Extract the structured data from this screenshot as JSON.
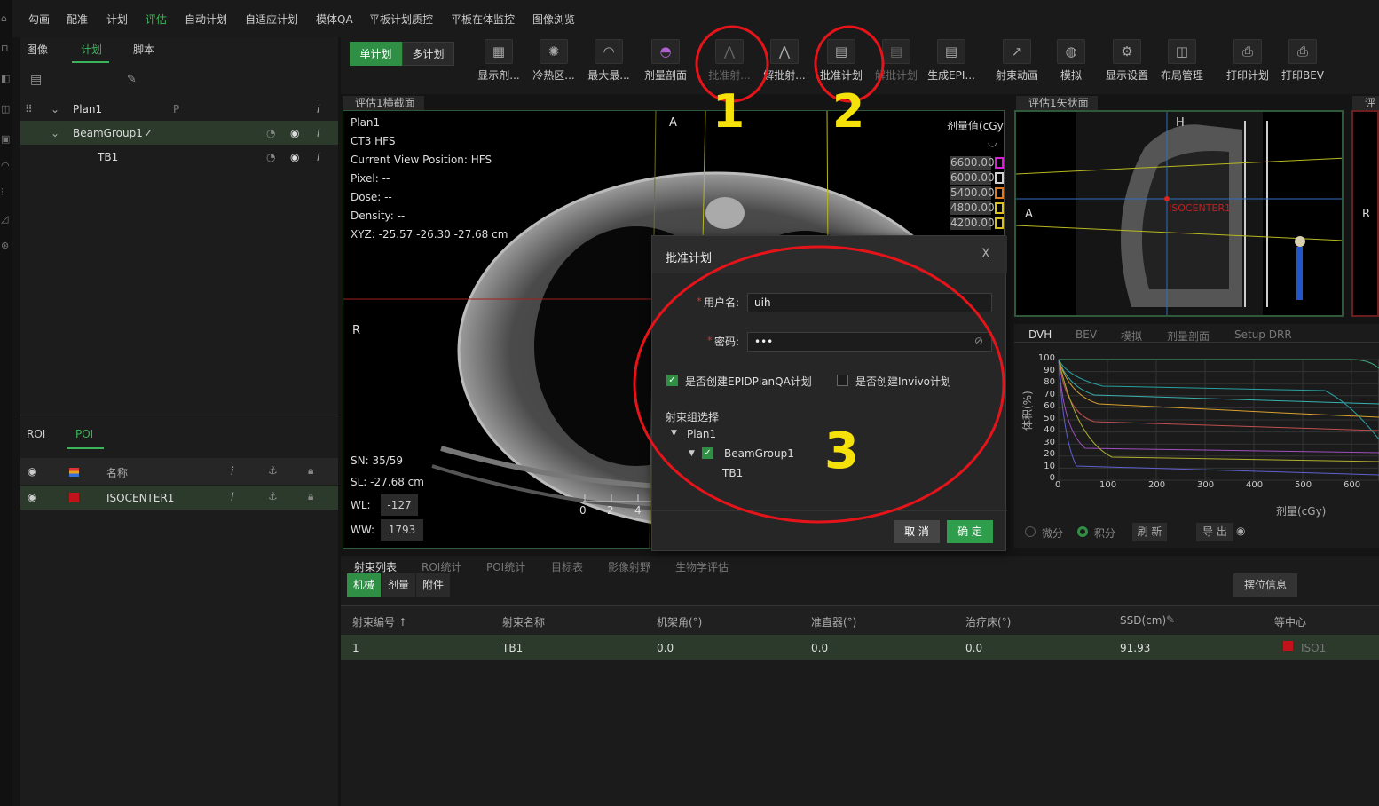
{
  "top_menu": [
    "勾画",
    "配准",
    "计划",
    "评估",
    "自动计划",
    "自适应计划",
    "模体QA",
    "平板计划质控",
    "平板在体监控",
    "图像浏览"
  ],
  "left_panel": {
    "tabs": [
      "图像",
      "计划",
      "脚本"
    ],
    "tree": {
      "plan": "Plan1",
      "beam_group": "BeamGroup1",
      "beam": "TB1"
    },
    "bottom_tabs": [
      "ROI",
      "POI"
    ],
    "poi_table": {
      "header_name": "名称",
      "row_name": "ISOCENTER1"
    }
  },
  "toolbar": {
    "plan_modes": [
      "单计划",
      "多计划"
    ],
    "tools": [
      "显示剂...",
      "冷热区...",
      "最大最...",
      "剂量剖面",
      "批准射...",
      "解批射...",
      "批准计划",
      "解批计划",
      "生成EPI...",
      "射束动画",
      "模拟",
      "显示设置",
      "布局管理",
      "打印计划",
      "打印BEV"
    ]
  },
  "axial": {
    "title": "评估1横截面",
    "overlay_lines": [
      "Plan1",
      "CT3 HFS",
      "Current View Position: HFS",
      "Pixel:  --",
      "Dose:  --",
      "Density:  --",
      "XYZ: -25.57 -26.30 -27.68 cm"
    ],
    "orient_top": "A",
    "orient_left": "R",
    "sn": "SN: 35/59",
    "sl": "SL: -27.68 cm",
    "wl_label": "WL:",
    "wl": "-127",
    "ww_label": "WW:",
    "ww": "1793",
    "dose_header": "剂量值(cGy)",
    "dose_levels": [
      "6600.00",
      "6000.00",
      "5400.00",
      "4800.00",
      "4200.00"
    ],
    "dose_colors": [
      "#d61fd6",
      "#d0d0d0",
      "#e07a20",
      "#d9c21f",
      "#d9c21f"
    ],
    "scale_labels": [
      "0",
      "2",
      "4"
    ]
  },
  "sagittal": {
    "title": "评估1矢状面",
    "orient_top": "H",
    "orient_left": "A",
    "isocenter": "ISOCENTER1"
  },
  "coronal": {
    "title": "评",
    "orient_right": "R"
  },
  "dvh": {
    "tabs": [
      "DVH",
      "BEV",
      "模拟",
      "剂量剖面",
      "Setup DRR"
    ],
    "ylabel": "体积(%)",
    "xlabel": "剂量(cGy)",
    "yticks": [
      "100",
      "90",
      "80",
      "70",
      "60",
      "50",
      "40",
      "30",
      "20",
      "10",
      "0"
    ],
    "xticks": [
      "100",
      "200",
      "300",
      "400",
      "500",
      "600"
    ],
    "options": [
      "微分",
      "积分"
    ],
    "refresh": "刷 新",
    "export": "导 出"
  },
  "bottom": {
    "tabs": [
      "射束列表",
      "ROI统计",
      "POI统计",
      "目标表",
      "影像射野",
      "生物学评估"
    ],
    "subtabs": [
      "机械",
      "剂量",
      "附件"
    ],
    "setup_button": "摆位信息",
    "columns": [
      "射束编号 ↑",
      "射束名称",
      "机架角(°)",
      "准直器(°)",
      "治疗床(°)",
      "SSD(cm)",
      "等中心"
    ],
    "row": [
      "1",
      "TB1",
      "0.0",
      "0.0",
      "0.0",
      "91.93",
      "ISO1"
    ]
  },
  "modal": {
    "title": "批准计划",
    "close": "X",
    "username_label": "用户名:",
    "username_value": "uih",
    "password_label": "密码:",
    "password_value": "•••",
    "check_epid": "是否创建EPIDPlanQA计划",
    "check_invivo": "是否创建Invivo计划",
    "beam_group_select": "射束组选择",
    "tree_plan": "Plan1",
    "tree_group": "BeamGroup1",
    "tree_beam": "TB1",
    "cancel": "取 消",
    "ok": "确 定"
  },
  "annotations": [
    "1",
    "2",
    "3"
  ]
}
